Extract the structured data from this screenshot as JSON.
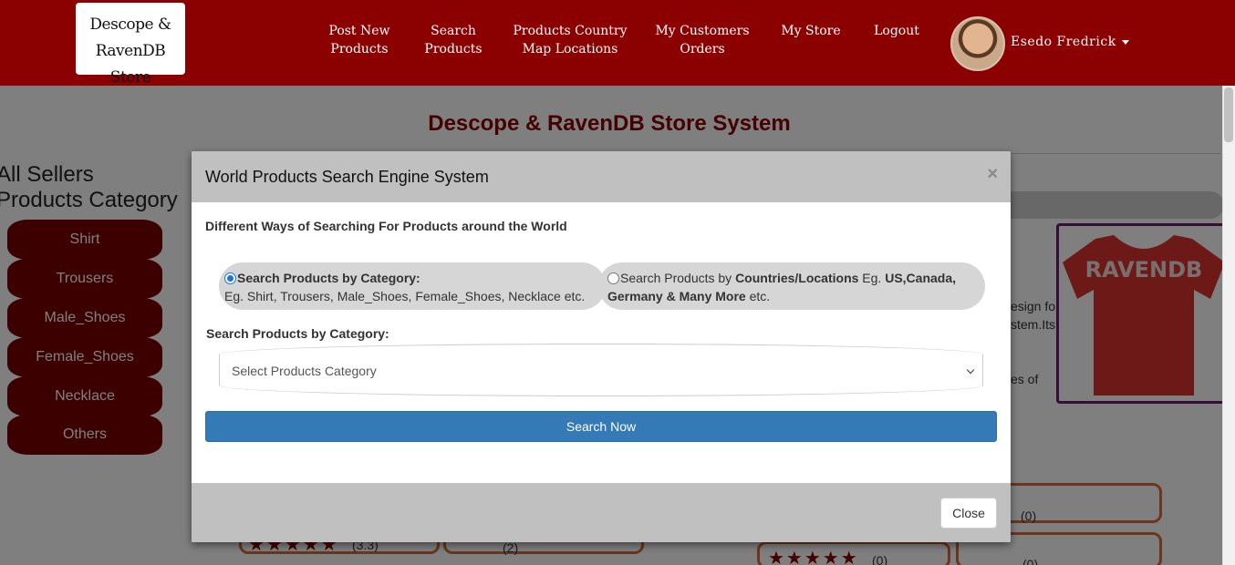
{
  "navbar": {
    "logo_line1": "Descope & RavenDB",
    "logo_line2": "Store",
    "items": [
      {
        "line1": "Post New",
        "line2": "Products"
      },
      {
        "line1": "Search",
        "line2": "Products"
      },
      {
        "line1": "Products Country",
        "line2": "Map Locations"
      },
      {
        "line1": "My Customers",
        "line2": "Orders"
      },
      {
        "line1": "My Store",
        "line2": ""
      },
      {
        "line1": "Logout",
        "line2": ""
      }
    ],
    "user_name": "Esedo Fredrick"
  },
  "page": {
    "title": "Descope & RavenDB Store System",
    "sidebar_title_line1": "All Sellers",
    "sidebar_title_line2": "Products Category",
    "categories": [
      "Shirt",
      "Trousers",
      "Male_Shoes",
      "Female_Shoes",
      "Necklace",
      "Others"
    ],
    "product_image_text": "RAVENDB",
    "bg_text_1": "esign for",
    "bg_text_2": "stem.Its",
    "bg_text_3": "es of",
    "rating_1": "(3.3)",
    "rating_2": "(2)",
    "rating_3": "(0)",
    "rating_4": "(0)",
    "rating_5": "(0)"
  },
  "modal": {
    "title": "World Products Search Engine System",
    "close_x": "×",
    "subtitle": "Different Ways of Searching For Products around the World",
    "option1_bold": "Search Products by Category:",
    "option1_desc": "Eg. Shirt, Trousers, Male_Shoes, Female_Shoes, Necklace etc.",
    "option2_prefix": "Search Products by ",
    "option2_bold": "Countries/Locations",
    "option2_mid": " Eg. ",
    "option2_bold2": "US,Canada,",
    "option2_bold3": "Germany & Many More",
    "option2_suffix": " etc.",
    "option1_selected": true,
    "select_label": "Search Products by Category:",
    "select_placeholder": "Select Products Category",
    "search_button": "Search Now",
    "close_button": "Close"
  },
  "colors": {
    "brand": "#8b0000",
    "primary_button": "#337ab7"
  }
}
